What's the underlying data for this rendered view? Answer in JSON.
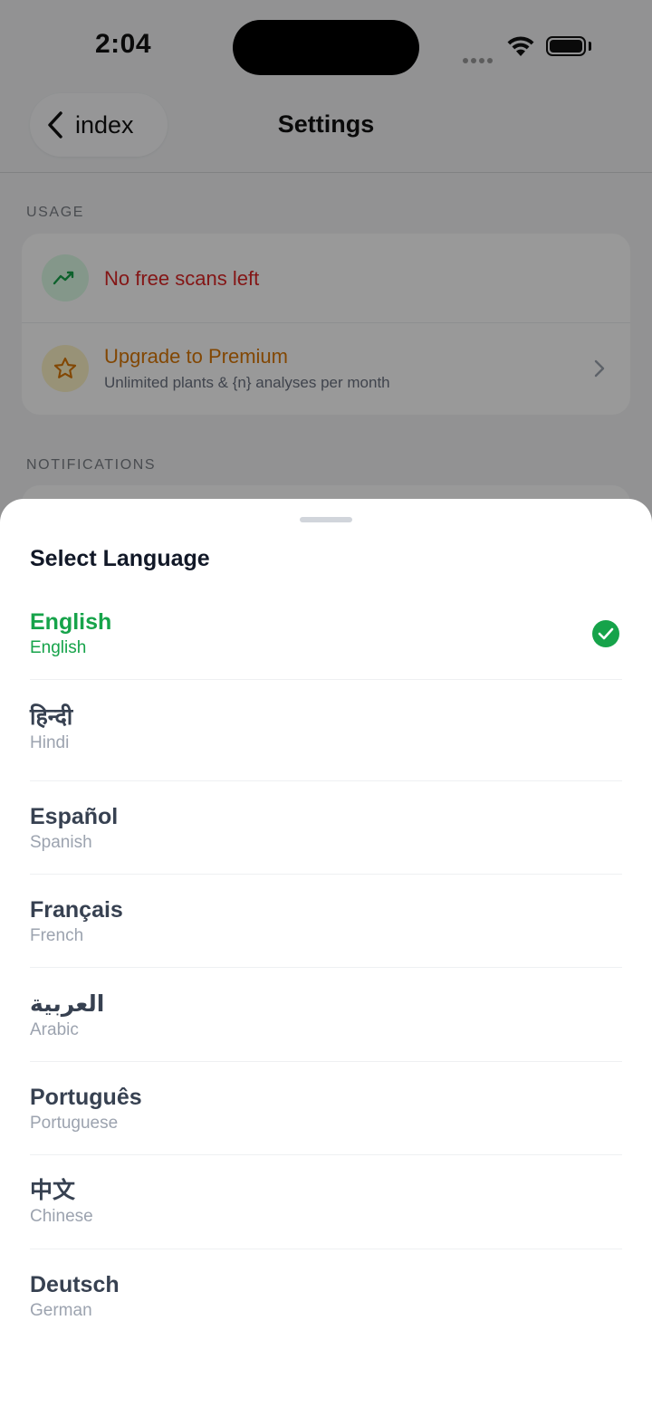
{
  "status_bar": {
    "time": "2:04"
  },
  "nav": {
    "back_label": "index",
    "title": "Settings"
  },
  "usage": {
    "header": "USAGE",
    "free_scans": {
      "title": "No free scans left",
      "icon": "trending-icon"
    },
    "premium": {
      "title": "Upgrade to Premium",
      "subtitle": "Unlimited plants & {n} analyses per month",
      "icon": "star-icon"
    }
  },
  "notifications": {
    "header": "NOTIFICATIONS"
  },
  "language_sheet": {
    "title": "Select Language",
    "languages": [
      {
        "native": "English",
        "english": "English",
        "selected": true
      },
      {
        "native": "हिन्दी",
        "english": "Hindi",
        "selected": false
      },
      {
        "native": "Español",
        "english": "Spanish",
        "selected": false
      },
      {
        "native": "Français",
        "english": "French",
        "selected": false
      },
      {
        "native": "العربية",
        "english": "Arabic",
        "selected": false
      },
      {
        "native": "Português",
        "english": "Portuguese",
        "selected": false
      },
      {
        "native": "中文",
        "english": "Chinese",
        "selected": false
      },
      {
        "native": "Deutsch",
        "english": "German",
        "selected": false
      }
    ]
  },
  "colors": {
    "accent_green": "#16a34a",
    "warning_red": "#dc2626",
    "premium_amber": "#d97706"
  }
}
